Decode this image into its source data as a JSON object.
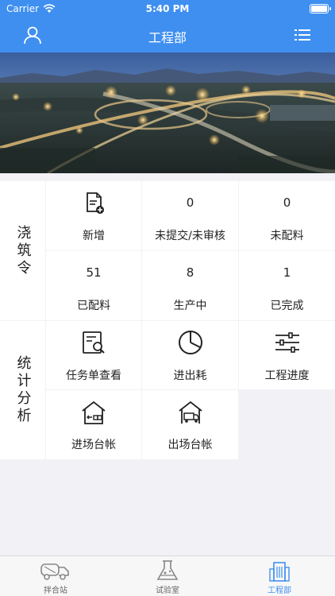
{
  "status_bar": {
    "carrier": "Carrier",
    "time": "5:40 PM"
  },
  "nav": {
    "title": "工程部",
    "left_icon": "user-icon",
    "right_icon": "list-icon"
  },
  "pour_order": {
    "label": "浇筑令",
    "cells": [
      {
        "icon": "new-document-icon",
        "value": "",
        "label": "新增"
      },
      {
        "value": "0",
        "label": "未提交/未审核"
      },
      {
        "value": "0",
        "label": "未配料"
      },
      {
        "value": "51",
        "label": "已配料"
      },
      {
        "value": "8",
        "label": "生产中"
      },
      {
        "value": "1",
        "label": "已完成"
      }
    ]
  },
  "stats": {
    "label": "统计分析",
    "cells": [
      {
        "icon": "task-search-icon",
        "label": "任务单查看"
      },
      {
        "icon": "pie-chart-icon",
        "label": "进出耗"
      },
      {
        "icon": "sliders-icon",
        "label": "工程进度"
      },
      {
        "icon": "warehouse-in-icon",
        "label": "进场台帐"
      },
      {
        "icon": "truck-out-icon",
        "label": "出场台帐"
      }
    ]
  },
  "tabbar": {
    "tabs": [
      {
        "label": "拌合站",
        "icon": "mixer-truck-icon",
        "active": false
      },
      {
        "label": "试验室",
        "icon": "flask-icon",
        "active": false
      },
      {
        "label": "工程部",
        "icon": "building-icon",
        "active": true
      }
    ]
  },
  "colors": {
    "primary": "#3f8ff0",
    "background": "#f2f2f6",
    "cell": "#ffffff"
  }
}
